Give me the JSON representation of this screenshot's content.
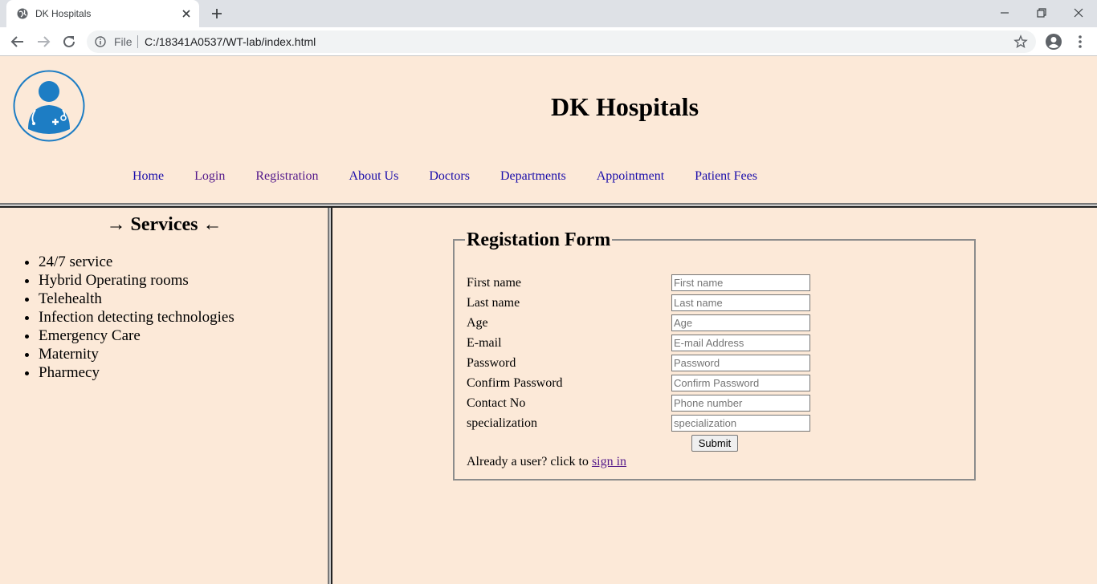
{
  "browser": {
    "tab_title": "DK Hospitals",
    "address_scheme": "File",
    "address_url": "C:/18341A0537/WT-lab/index.html"
  },
  "header": {
    "title": "DK Hospitals",
    "nav": [
      {
        "label": "Home"
      },
      {
        "label": "Login"
      },
      {
        "label": "Registration"
      },
      {
        "label": "About Us"
      },
      {
        "label": "Doctors"
      },
      {
        "label": "Departments"
      },
      {
        "label": "Appointment"
      },
      {
        "label": "Patient Fees"
      }
    ]
  },
  "services": {
    "title": "→ Services ←",
    "items": [
      "24/7 service",
      "Hybrid Operating rooms",
      "Telehealth",
      "Infection detecting technologies",
      "Emergency Care",
      "Maternity",
      "Pharmecy"
    ]
  },
  "form": {
    "legend": "Registation Form",
    "fields": [
      {
        "label": "First name",
        "placeholder": "First name"
      },
      {
        "label": "Last name",
        "placeholder": "Last name"
      },
      {
        "label": "Age",
        "placeholder": "Age"
      },
      {
        "label": "E-mail",
        "placeholder": "E-mail Address"
      },
      {
        "label": "Password",
        "placeholder": "Password"
      },
      {
        "label": "Confirm Password",
        "placeholder": "Confirm Password"
      },
      {
        "label": "Contact No",
        "placeholder": "Phone number"
      },
      {
        "label": "specialization",
        "placeholder": "specialization"
      }
    ],
    "submit_label": "Submit",
    "signin_prefix": "Already a user? click to",
    "signin_link": "sign in"
  },
  "colors": {
    "page_background": "#fce9d8",
    "link": "#1a0dab",
    "visited_link": "#551a8b",
    "logo_blue": "#1d7dc4"
  }
}
